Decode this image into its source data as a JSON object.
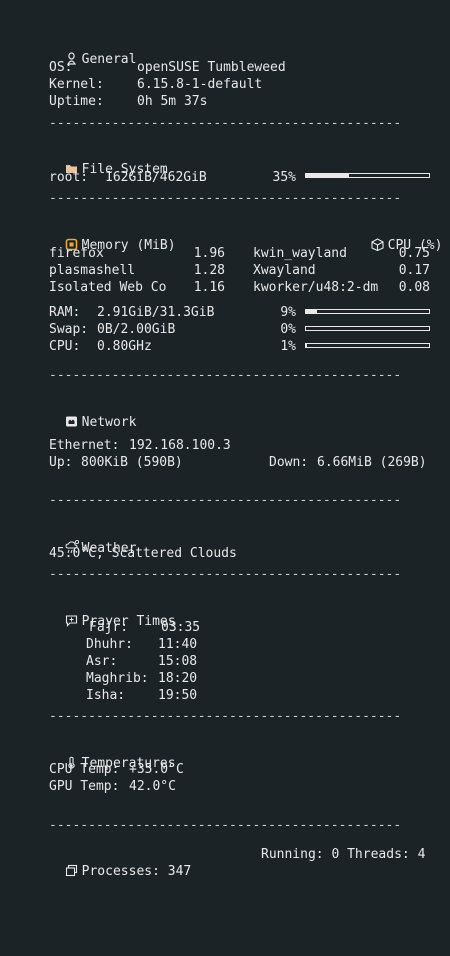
{
  "general": {
    "title": "General",
    "os_label": "OS:",
    "os_value": "openSUSE Tumbleweed",
    "kernel_label": "Kernel:",
    "kernel_value": "6.15.8-1-default",
    "uptime_label": "Uptime:",
    "uptime_value": "0h 5m 37s"
  },
  "separator": "---------------------------------------------",
  "filesystem": {
    "title": "File System",
    "root_label": "root:",
    "root_value": "162GiB/462GiB",
    "root_percent_text": "35%",
    "root_percent": 0.35
  },
  "memory": {
    "title": "Memory (MiB)",
    "cpu_title": "CPU (%)",
    "mem_procs": [
      {
        "name": "firefox",
        "value": "1.96"
      },
      {
        "name": "plasmashell",
        "value": "1.28"
      },
      {
        "name": "Isolated Web Co",
        "value": "1.16"
      }
    ],
    "cpu_procs": [
      {
        "name": "kwin_wayland",
        "value": "0.75"
      },
      {
        "name": "Xwayland",
        "value": "0.17"
      },
      {
        "name": "kworker/u48:2-dm",
        "value": "0.08"
      }
    ],
    "ram_label": "RAM:",
    "ram_value": "2.91GiB/31.3GiB",
    "ram_percent_text": "9%",
    "ram_percent": 0.09,
    "swap_label": "Swap:",
    "swap_value": "0B/2.00GiB",
    "swap_percent_text": "0%",
    "swap_percent": 0.0,
    "cpu_label": "CPU:",
    "cpu_value": "0.80GHz",
    "cpu_percent_text": "1%",
    "cpu_percent": 0.01
  },
  "network": {
    "title": "Network",
    "ethernet_label": "Ethernet:",
    "ethernet_value": "192.168.100.3",
    "up_label": "Up:",
    "up_value": "800KiB (590B)",
    "down_label": "Down:",
    "down_value": "6.66MiB (269B)"
  },
  "weather": {
    "title": "Weather",
    "value": "45.0°C, Scattered Clouds"
  },
  "prayer": {
    "title": "Prayer Times",
    "times": [
      {
        "name": "Fajr:",
        "time": "03:35"
      },
      {
        "name": "Dhuhr:",
        "time": "11:40"
      },
      {
        "name": "Asr:",
        "time": "15:08"
      },
      {
        "name": "Maghrib:",
        "time": "18:20"
      },
      {
        "name": "Isha:",
        "time": "19:50"
      }
    ]
  },
  "temperatures": {
    "title": "Temperatures",
    "cpu_label": "CPU Temp:",
    "cpu_value": "+35.0°C",
    "gpu_label": "GPU Temp:",
    "gpu_value": "42.0°C"
  },
  "footer": {
    "processes_label": "Processes:",
    "processes_value": "347",
    "running_label": "Running:",
    "running_value": "0",
    "threads_label": "Threads:",
    "threads_value": "4"
  },
  "colors": {
    "background": "#1b2326",
    "text": "#e8e8e8",
    "memory_icon": "#e8a93a"
  },
  "icons": {
    "general": "tux-icon",
    "filesystem": "folder-icon",
    "memory": "memory-icon",
    "cpu": "cube-icon",
    "network": "network-icon",
    "weather": "cloud-rain-icon",
    "prayer": "chat-icon",
    "temperatures": "thermometer-icon",
    "processes": "windows-icon"
  }
}
